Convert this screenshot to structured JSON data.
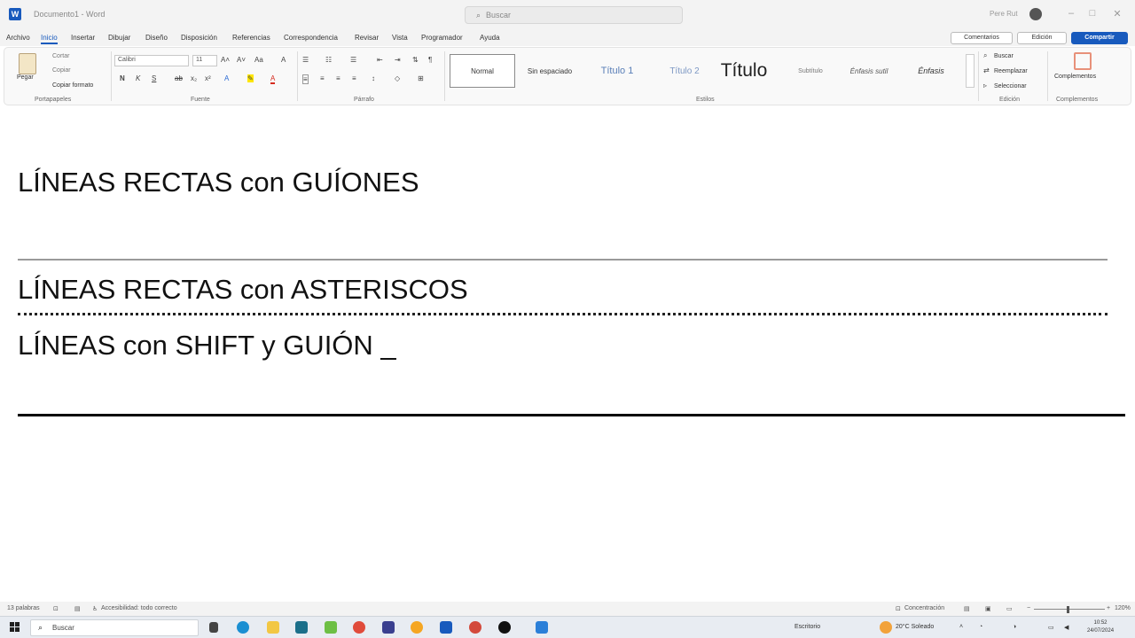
{
  "window": {
    "doc_title": "Documento1 - Word",
    "search_placeholder": "Buscar",
    "user_name": "Pere Rut",
    "controls": [
      "–",
      "□",
      "✕"
    ]
  },
  "menu": {
    "tabs": [
      "Archivo",
      "Inicio",
      "Insertar",
      "Dibujar",
      "Diseño",
      "Disposición",
      "Referencias",
      "Correspondencia",
      "Revisar",
      "Vista",
      "Programador",
      "Ayuda"
    ],
    "active_tab": "Inicio",
    "comments_label": "Comentarios",
    "edit_label": "Edición",
    "share_label": "Compartir"
  },
  "ribbon": {
    "clipboard": {
      "paste": "Pegar",
      "cut": "Cortar",
      "copy": "Copiar",
      "format_painter": "Copiar formato",
      "label": "Portapapeles"
    },
    "font": {
      "name": "Calibri",
      "size": "11",
      "label": "Fuente"
    },
    "paragraph_label": "Párrafo",
    "styles": {
      "items": [
        "Normal",
        "Sin espaciado",
        "Título 1",
        "Título 2",
        "Título",
        "Subtítulo",
        "Énfasis sutil",
        "Énfasis"
      ],
      "label": "Estilos"
    },
    "editing": {
      "find": "Buscar",
      "replace": "Reemplazar",
      "select": "Seleccionar",
      "label": "Edición"
    },
    "addins": {
      "button": "Complementos",
      "label": "Complementos"
    }
  },
  "document": {
    "lines": [
      "LÍNEAS RECTAS con GUÍONES",
      "LÍNEAS RECTAS con ASTERISCOS",
      "LÍNEAS con SHIFT y GUIÓN _"
    ]
  },
  "statusbar": {
    "word_count": "13 palabras",
    "accessibility": "Accesibilidad: todo correcto",
    "focus": "Concentración",
    "zoom": "120%"
  },
  "taskbar": {
    "search_placeholder": "Buscar",
    "desktop_label": "Escritorio",
    "weather": "20°C  Soleado",
    "time": "10:52",
    "date": "24/07/2024"
  }
}
